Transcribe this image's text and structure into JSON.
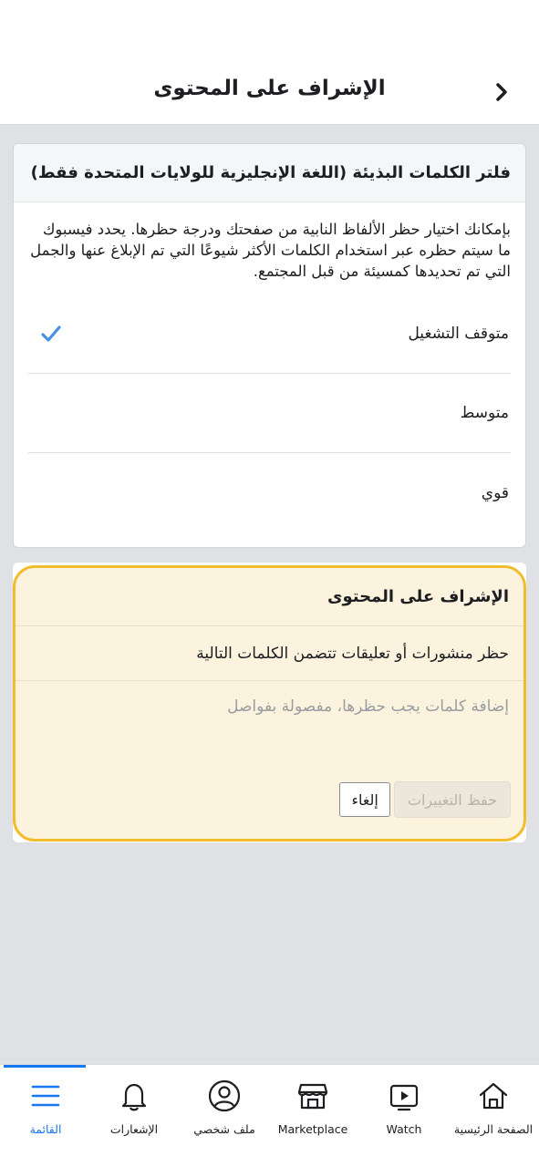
{
  "header": {
    "title": "الإشراف على المحتوى"
  },
  "profanity_filter": {
    "title": "فلتر الكلمات البذيئة (اللغة الإنجليزية للولايات المتحدة فقط)",
    "description": "بإمكانك اختيار حظر الألفاظ النابية من صفحتك ودرجة حظرها. يحدد فيسبوك ما سيتم حظره عبر استخدام الكلمات الأكثر شيوعًا التي تم الإبلاغ عنها والجمل التي تم تحديدها كمسيئة من قبل المجتمع.",
    "options": [
      {
        "label": "متوقف التشغيل",
        "selected": true
      },
      {
        "label": "متوسط",
        "selected": false
      },
      {
        "label": "قوي",
        "selected": false
      }
    ]
  },
  "moderation": {
    "title": "الإشراف على المحتوى",
    "subtitle": "حظر منشورات أو تعليقات تتضمن الكلمات التالية",
    "input_placeholder": "إضافة كلمات يجب حظرها، مفصولة بفواصل",
    "save_label": "حفظ التغييرات",
    "cancel_label": "إلغاء"
  },
  "tabbar": {
    "items": [
      {
        "label": "الصفحة الرئيسية",
        "icon": "home-icon"
      },
      {
        "label": "Watch",
        "icon": "watch-icon"
      },
      {
        "label": "Marketplace",
        "icon": "marketplace-icon"
      },
      {
        "label": "ملف شخصي",
        "icon": "profile-icon"
      },
      {
        "label": "الإشعارات",
        "icon": "bell-icon"
      },
      {
        "label": "القائمة",
        "icon": "menu-icon",
        "active": true
      }
    ]
  },
  "colors": {
    "accent": "#1877f2",
    "highlight_border": "#f2bd2c",
    "highlight_fill": "#fbf3dd"
  }
}
